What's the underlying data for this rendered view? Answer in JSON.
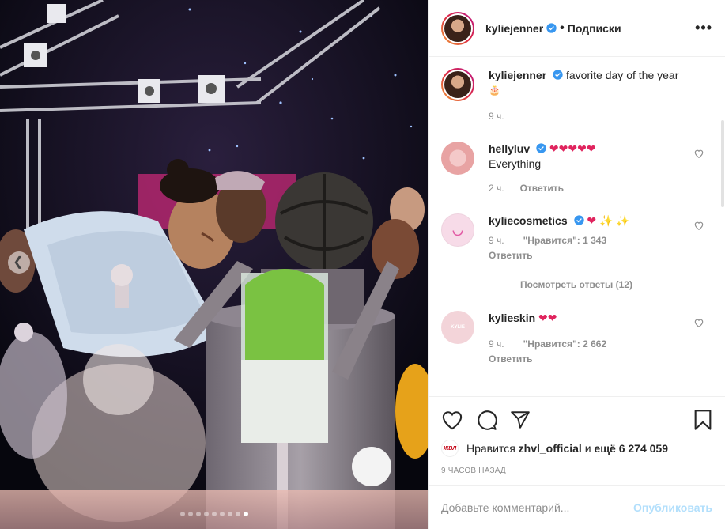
{
  "header": {
    "username": "kyliejenner",
    "separator": "•",
    "follow_label": "Подписки",
    "more_label": "•••"
  },
  "caption": {
    "username": "kyliejenner",
    "text": "favorite day of the year",
    "emoji": "🎂",
    "time": "9 ч."
  },
  "comments": [
    {
      "username": "hellyluv",
      "emojis": "❤❤❤❤❤",
      "text": "Everything",
      "time": "2 ч.",
      "likes": "",
      "reply_label": "Ответить"
    },
    {
      "username": "kyliecosmetics",
      "emojis": "❤ ✨ ✨",
      "text": "",
      "time": "9 ч.",
      "likes": "\"Нравится\": 1 343",
      "reply_label": "Ответить"
    },
    {
      "username": "kylieskin",
      "emojis": "❤❤",
      "text": "",
      "time": "9 ч.",
      "likes": "\"Нравится\": 2 662",
      "reply_label": "Ответить"
    }
  ],
  "view_replies_label": "Посмотреть ответы (12)",
  "likes": {
    "avatar_text": "ЖВЛ",
    "prefix": "Нравится",
    "user": "zhvl_official",
    "connector": "и",
    "others": "ещё 6 274 059"
  },
  "timestamp": "9 ЧАСОВ НАЗАД",
  "add_comment": {
    "placeholder": "Добавьте комментарий...",
    "publish_label": "Опубликовать"
  },
  "carousel": {
    "count": 9,
    "active": 8
  },
  "colors": {
    "verified": "#3897f0",
    "heart": "#e0245e",
    "publish": "#b2dffc"
  },
  "icons": [
    "like-icon",
    "comment-icon",
    "share-icon",
    "bookmark-icon",
    "prev-arrow-icon",
    "more-icon",
    "verified-icon"
  ]
}
